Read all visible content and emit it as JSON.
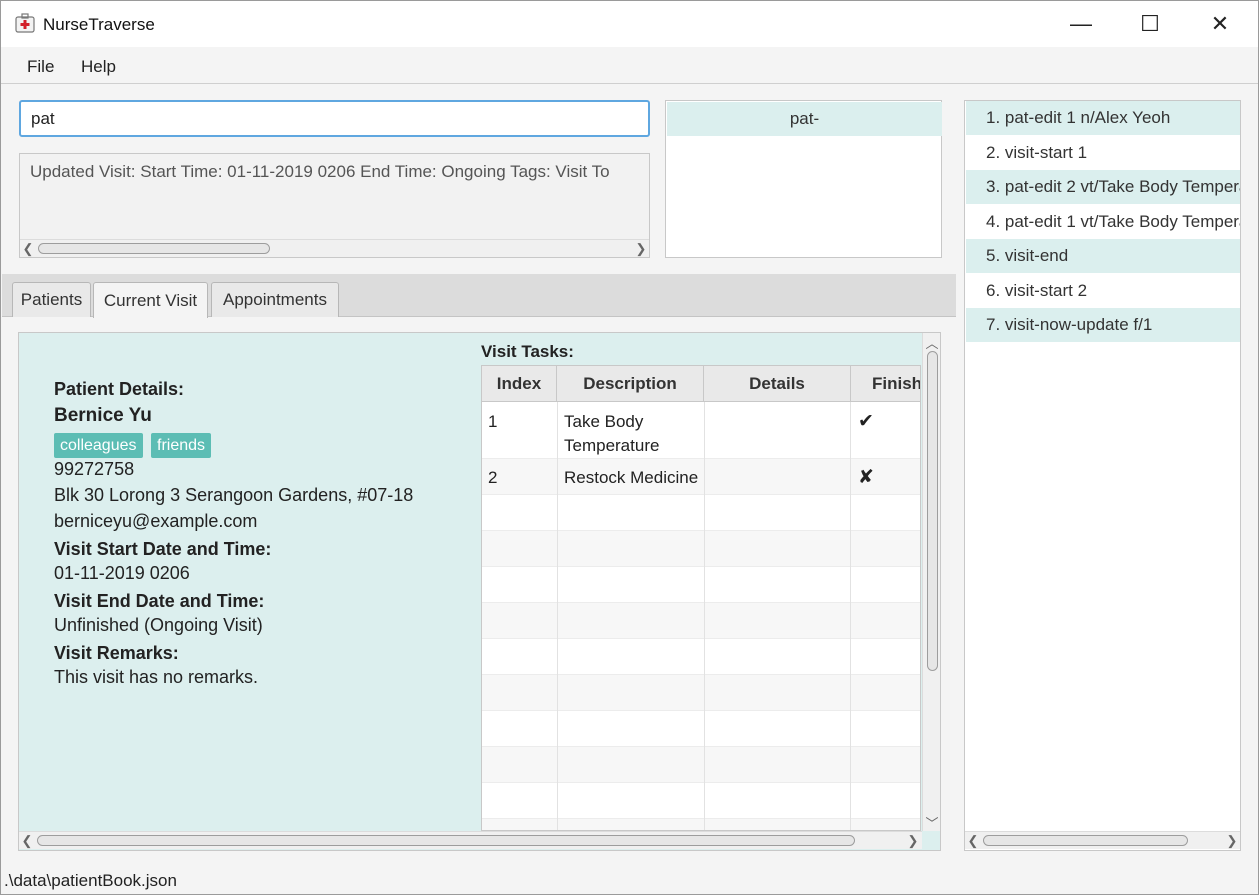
{
  "window": {
    "title": "NurseTraverse",
    "controls": {
      "minimize": "—",
      "maximize": "☐",
      "close": "✕"
    }
  },
  "menu": {
    "items": [
      "File",
      "Help"
    ]
  },
  "command": {
    "value": "pat"
  },
  "result": {
    "text": "Updated Visit:  Start Time: 01-11-2019 0206 End Time: Ongoing Tags:  Visit To"
  },
  "suggestions": {
    "items": [
      "pat-"
    ]
  },
  "history": {
    "items": [
      "1. pat-edit 1 n/Alex Yeoh",
      "2. visit-start 1",
      "3. pat-edit 2 vt/Take Body Tempera",
      "4. pat-edit 1 vt/Take Body Tempera",
      "5. visit-end",
      "6. visit-start 2",
      "7. visit-now-update f/1"
    ]
  },
  "tabs": {
    "items": [
      "Patients",
      "Current Visit",
      "Appointments"
    ],
    "active": "Current Visit"
  },
  "visit": {
    "patient_details_label": "Patient Details:",
    "name": "Bernice Yu",
    "tags": [
      "colleagues",
      "friends"
    ],
    "phone": "99272758",
    "address": "Blk 30 Lorong 3 Serangoon Gardens, #07-18",
    "email": "berniceyu@example.com",
    "start_label": "Visit Start Date and Time:",
    "start": "01-11-2019 0206",
    "end_label": "Visit End Date and Time:",
    "end": "Unfinished (Ongoing Visit)",
    "remarks_label": "Visit Remarks:",
    "remarks": "This visit has no remarks."
  },
  "tasks": {
    "label": "Visit Tasks:",
    "columns": [
      "Index",
      "Description",
      "Details",
      "Finish"
    ],
    "rows": [
      {
        "index": "1",
        "description_line1": "Take Body",
        "description_line2": "Temperature",
        "details": "",
        "finished": "✔"
      },
      {
        "index": "2",
        "description_line1": "Restock Medicine",
        "description_line2": "",
        "details": "",
        "finished": "✘"
      }
    ]
  },
  "status": {
    "file_path": ".\\data\\patientBook.json"
  },
  "colors": {
    "accent": "#5fa7e0",
    "row_highlight": "#dbefee",
    "tag": "#5cbdb4",
    "panel": "#dcefee"
  }
}
